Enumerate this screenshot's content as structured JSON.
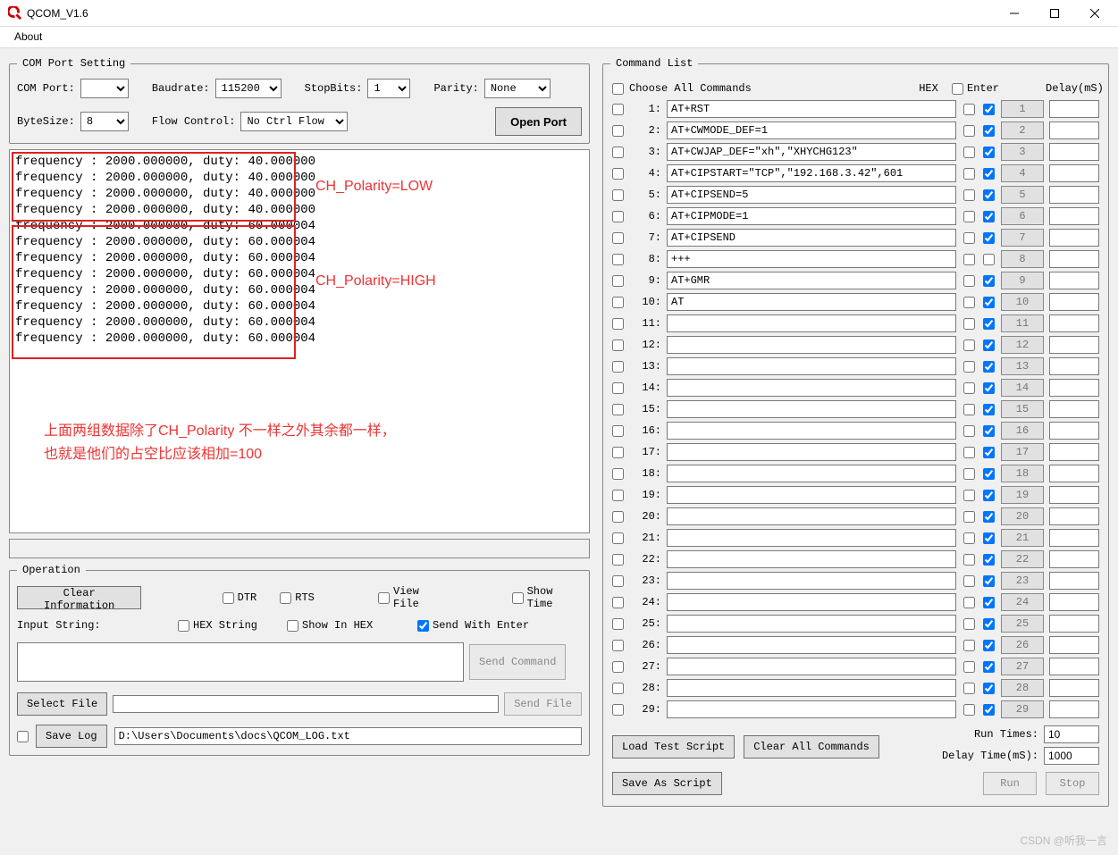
{
  "window": {
    "title": "QCOM_V1.6"
  },
  "menu": {
    "about": "About"
  },
  "com": {
    "legend": "COM Port Setting",
    "comport_label": "COM Port:",
    "comport_value": "",
    "baud_label": "Baudrate:",
    "baud_value": "115200",
    "stopbits_label": "StopBits:",
    "stopbits_value": "1",
    "parity_label": "Parity:",
    "parity_value": "None",
    "bytesize_label": "ByteSize:",
    "bytesize_value": "8",
    "flow_label": "Flow Control:",
    "flow_value": "No Ctrl Flow",
    "open_btn": "Open Port"
  },
  "console_lines": "frequency : 2000.000000, duty: 40.000000\nfrequency : 2000.000000, duty: 40.000000\nfrequency : 2000.000000, duty: 40.000000\nfrequency : 2000.000000, duty: 40.000000\nfrequency : 2000.000000, duty: 60.000004\nfrequency : 2000.000000, duty: 60.000004\nfrequency : 2000.000000, duty: 60.000004\nfrequency : 2000.000000, duty: 60.000004\nfrequency : 2000.000000, duty: 60.000004\nfrequency : 2000.000000, duty: 60.000004\nfrequency : 2000.000000, duty: 60.000004\nfrequency : 2000.000000, duty: 60.000004",
  "annot": {
    "low": "CH_Polarity=LOW",
    "high": "CH_Polarity=HIGH",
    "note1": "上面两组数据除了CH_Polarity 不一样之外其余都一样，",
    "note2": "也就是他们的占空比应该相加=100"
  },
  "operation": {
    "legend": "Operation",
    "clear_btn": "Clear Information",
    "dtr": "DTR",
    "rts": "RTS",
    "viewfile": "View File",
    "showtime": "Show Time",
    "hexstring": "HEX String",
    "showinhex": "Show In HEX",
    "sendwithenter": "Send With Enter",
    "sendwithenter_checked": true,
    "input_label": "Input String:",
    "sendcmd_btn": "Send Command",
    "selectfile_btn": "Select File",
    "sendfile_btn": "Send File",
    "savelog_label": "Save Log",
    "logpath": "D:\\Users\\Documents\\docs\\QCOM_LOG.txt"
  },
  "cmd": {
    "legend": "Command List",
    "chooseall": "Choose All Commands",
    "hex_col": "HEX",
    "enter_col": "Enter",
    "delay_col": "Delay(mS)",
    "rows": [
      {
        "n": 1,
        "cmd": "AT+RST",
        "enter": true
      },
      {
        "n": 2,
        "cmd": "AT+CWMODE_DEF=1",
        "enter": true
      },
      {
        "n": 3,
        "cmd": "AT+CWJAP_DEF=\"xh\",\"XHYCHG123\"",
        "enter": true
      },
      {
        "n": 4,
        "cmd": "AT+CIPSTART=\"TCP\",\"192.168.3.42\",601",
        "enter": true
      },
      {
        "n": 5,
        "cmd": "AT+CIPSEND=5",
        "enter": true
      },
      {
        "n": 6,
        "cmd": "AT+CIPMODE=1",
        "enter": true
      },
      {
        "n": 7,
        "cmd": "AT+CIPSEND",
        "enter": true
      },
      {
        "n": 8,
        "cmd": "+++",
        "enter": false
      },
      {
        "n": 9,
        "cmd": "AT+GMR",
        "enter": true
      },
      {
        "n": 10,
        "cmd": "AT",
        "enter": true
      },
      {
        "n": 11,
        "cmd": "",
        "enter": true
      },
      {
        "n": 12,
        "cmd": "",
        "enter": true
      },
      {
        "n": 13,
        "cmd": "",
        "enter": true
      },
      {
        "n": 14,
        "cmd": "",
        "enter": true
      },
      {
        "n": 15,
        "cmd": "",
        "enter": true
      },
      {
        "n": 16,
        "cmd": "",
        "enter": true
      },
      {
        "n": 17,
        "cmd": "",
        "enter": true
      },
      {
        "n": 18,
        "cmd": "",
        "enter": true
      },
      {
        "n": 19,
        "cmd": "",
        "enter": true
      },
      {
        "n": 20,
        "cmd": "",
        "enter": true
      },
      {
        "n": 21,
        "cmd": "",
        "enter": true
      },
      {
        "n": 22,
        "cmd": "",
        "enter": true
      },
      {
        "n": 23,
        "cmd": "",
        "enter": true
      },
      {
        "n": 24,
        "cmd": "",
        "enter": true
      },
      {
        "n": 25,
        "cmd": "",
        "enter": true
      },
      {
        "n": 26,
        "cmd": "",
        "enter": true
      },
      {
        "n": 27,
        "cmd": "",
        "enter": true
      },
      {
        "n": 28,
        "cmd": "",
        "enter": true
      },
      {
        "n": 29,
        "cmd": "",
        "enter": true
      }
    ],
    "loadscript_btn": "Load Test Script",
    "clearall_btn": "Clear All Commands",
    "saveas_btn": "Save As Script",
    "runtimes_label": "Run Times:",
    "runtimes_value": "10",
    "delaytime_label": "Delay Time(mS):",
    "delaytime_value": "1000",
    "run_btn": "Run",
    "stop_btn": "Stop"
  },
  "watermark": "CSDN @听我一言"
}
